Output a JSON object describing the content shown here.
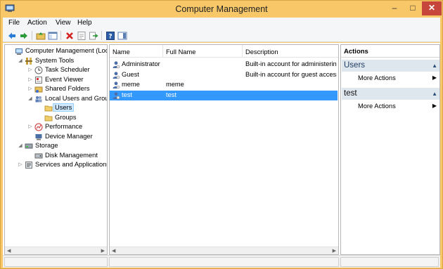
{
  "window": {
    "title": "Computer Management"
  },
  "menu": [
    "File",
    "Action",
    "View",
    "Help"
  ],
  "toolbar": {
    "icons": [
      "back-icon",
      "forward-icon",
      "up-folder-icon",
      "show-hide-tree-icon",
      "delete-icon",
      "properties-icon",
      "export-icon",
      "help-icon",
      "show-action-pane-icon"
    ]
  },
  "tree": {
    "items": [
      {
        "label": "Computer Management (Local",
        "level": 0,
        "expander": "",
        "icon": "computer-management-icon"
      },
      {
        "label": "System Tools",
        "level": 1,
        "expander": "◢",
        "icon": "tools-icon"
      },
      {
        "label": "Task Scheduler",
        "level": 2,
        "expander": "▷",
        "icon": "clock-icon"
      },
      {
        "label": "Event Viewer",
        "level": 2,
        "expander": "▷",
        "icon": "event-viewer-icon"
      },
      {
        "label": "Shared Folders",
        "level": 2,
        "expander": "▷",
        "icon": "shared-folder-icon"
      },
      {
        "label": "Local Users and Groups",
        "level": 2,
        "expander": "◢",
        "icon": "users-groups-icon"
      },
      {
        "label": "Users",
        "level": 3,
        "expander": "",
        "icon": "folder-icon",
        "selected": true
      },
      {
        "label": "Groups",
        "level": 3,
        "expander": "",
        "icon": "folder-icon"
      },
      {
        "label": "Performance",
        "level": 2,
        "expander": "▷",
        "icon": "performance-icon"
      },
      {
        "label": "Device Manager",
        "level": 2,
        "expander": "",
        "icon": "device-manager-icon"
      },
      {
        "label": "Storage",
        "level": 1,
        "expander": "◢",
        "icon": "storage-icon"
      },
      {
        "label": "Disk Management",
        "level": 2,
        "expander": "",
        "icon": "disk-icon"
      },
      {
        "label": "Services and Applications",
        "level": 1,
        "expander": "▷",
        "icon": "services-icon"
      }
    ]
  },
  "list": {
    "columns": [
      "Name",
      "Full Name",
      "Description"
    ],
    "rows": [
      {
        "name": "Administrator",
        "full_name": "",
        "description": "Built-in account for administering",
        "icon": "user-icon"
      },
      {
        "name": "Guest",
        "full_name": "",
        "description": "Built-in account for guest access t",
        "icon": "user-icon"
      },
      {
        "name": "meme",
        "full_name": "meme",
        "description": "",
        "icon": "user-icon"
      },
      {
        "name": "test",
        "full_name": "test",
        "description": "",
        "icon": "user-icon",
        "selected": true
      }
    ]
  },
  "actions": {
    "title": "Actions",
    "sections": [
      {
        "heading": "Users",
        "items": [
          "More Actions"
        ]
      },
      {
        "heading": "test",
        "items": [
          "More Actions"
        ]
      }
    ]
  },
  "colors": {
    "title_bar": "#f7c768",
    "selection": "#3399ff",
    "close_button": "#c7463b"
  }
}
